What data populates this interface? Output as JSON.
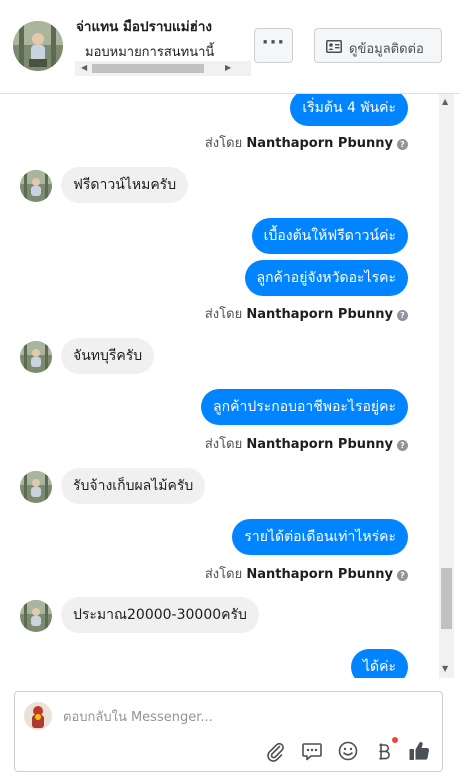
{
  "header": {
    "contact_name": "จ่าแทน มือปราบแม่ฮ่าง",
    "subtitle": "มอบหมายการสนทนานี้",
    "more_label": "···",
    "contact_button_label": "ดูข้อมูลติดต่อ"
  },
  "messages": [
    {
      "type": "out",
      "text": "เริ่มต้น 4 พันค่ะ"
    },
    {
      "type": "sent_by",
      "prefix": "ส่งโดย",
      "name": "Nanthaporn Pbunny"
    },
    {
      "type": "in",
      "text": "ฟรีดาวน์ไหมครับ"
    },
    {
      "type": "out",
      "text": "เบื้องต้นให้ฟรีดาวน์ค่ะ"
    },
    {
      "type": "out",
      "text": "ลูกค้าอยู่จังหวัดอะไรคะ"
    },
    {
      "type": "sent_by",
      "prefix": "ส่งโดย",
      "name": "Nanthaporn Pbunny"
    },
    {
      "type": "in",
      "text": "จันทบุรีครับ"
    },
    {
      "type": "out",
      "text": "ลูกค้าประกอบอาชีพอะไรอยู่คะ"
    },
    {
      "type": "sent_by",
      "prefix": "ส่งโดย",
      "name": "Nanthaporn Pbunny"
    },
    {
      "type": "in",
      "text": "รับจ้างเก็บผลไม้ครับ"
    },
    {
      "type": "out",
      "text": "รายได้ต่อเดือนเท่าไหร่คะ"
    },
    {
      "type": "sent_by",
      "prefix": "ส่งโดย",
      "name": "Nanthaporn Pbunny"
    },
    {
      "type": "in",
      "text": "ประมาณ20000-30000ครับ"
    },
    {
      "type": "out",
      "text": "ได้ค่ะ"
    }
  ],
  "composer": {
    "placeholder": "ตอบกลับใน Messenger..."
  },
  "colors": {
    "accent": "#0084ff",
    "incoming_bubble": "#f1f0f0",
    "notification_dot": "#fa3e3e"
  },
  "icons": [
    "ellipsis-icon",
    "contact-card-icon",
    "info-icon",
    "paperclip-icon",
    "chat-bubble-icon",
    "smiley-icon",
    "baht-icon",
    "thumbs-up-icon"
  ]
}
